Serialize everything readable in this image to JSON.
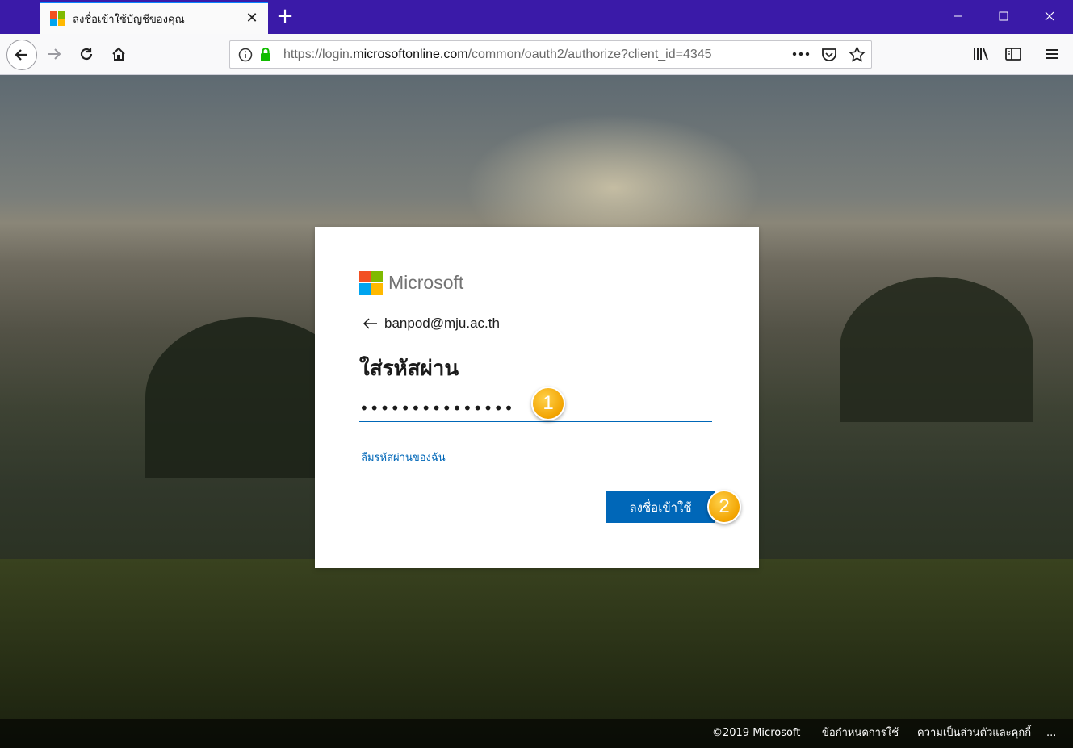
{
  "browser": {
    "tab_title": "ลงชื่อเข้าใช้บัญชีของคุณ",
    "tab_close": "✕",
    "new_tab": "+",
    "url_prefix": "https://login.",
    "url_domain": "microsoftonline.com",
    "url_path": "/common/oauth2/authorize?client_id=4345"
  },
  "signin_card": {
    "brand": "Microsoft",
    "identity": "banpod@mju.ac.th",
    "heading": "ใส่รหัสผ่าน",
    "password_value": "•••••••••••••••",
    "forgot_link": "ลืมรหัสผ่านของฉัน",
    "signin_button": "ลงชื่อเข้าใช้"
  },
  "annotations": {
    "marker1": "1",
    "marker2": "2"
  },
  "footer": {
    "copyright": "©2019 Microsoft",
    "terms": "ข้อกำหนดการใช้",
    "privacy": "ความเป็นส่วนตัวและคุกกี้",
    "more": "..."
  },
  "colors": {
    "ms_red": "#f25022",
    "ms_green": "#7fba00",
    "ms_blue": "#00a4ef",
    "ms_yellow": "#ffb900",
    "accent": "#0067b8"
  }
}
